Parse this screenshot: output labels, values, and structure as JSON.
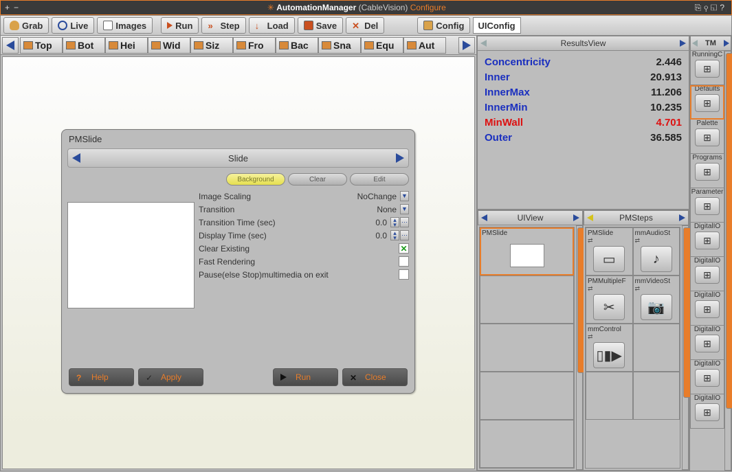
{
  "title": {
    "app": "AutomationManager",
    "project": "(CableVision)",
    "mode": "Configure"
  },
  "toolbar": {
    "grab": "Grab",
    "live": "Live",
    "images": "Images",
    "run": "Run",
    "step": "Step",
    "load": "Load",
    "save": "Save",
    "del": "Del",
    "config": "Config",
    "uiconfig": "UIConfig"
  },
  "sec_toolbar": {
    "items": [
      "Top",
      "Bot",
      "Hei",
      "Wid",
      "Siz",
      "Fro",
      "Bac",
      "Sna",
      "Equ",
      "Aut"
    ]
  },
  "dialog": {
    "title": "PMSlide",
    "header": "Slide",
    "tabs": {
      "background": "Background",
      "clear": "Clear",
      "edit": "Edit"
    },
    "props": {
      "image_scaling": {
        "label": "Image Scaling",
        "value": "NoChange"
      },
      "transition": {
        "label": "Transition",
        "value": "None"
      },
      "transition_time": {
        "label": "Transition Time (sec)",
        "value": "0.0"
      },
      "display_time": {
        "label": "Display Time (sec)",
        "value": "0.0"
      },
      "clear_existing": {
        "label": "Clear Existing",
        "value": true
      },
      "fast_rendering": {
        "label": "Fast Rendering",
        "value": false
      },
      "pause_stop": {
        "label": "Pause(else Stop)multimedia on exit",
        "value": false
      }
    },
    "buttons": {
      "help": "Help",
      "apply": "Apply",
      "run": "Run",
      "close": "Close"
    }
  },
  "results": {
    "title": "ResultsView",
    "rows": [
      {
        "name": "Concentricity",
        "value": "2.446",
        "alert": false
      },
      {
        "name": "Inner",
        "value": "20.913",
        "alert": false
      },
      {
        "name": "InnerMax",
        "value": "11.206",
        "alert": false
      },
      {
        "name": "InnerMin",
        "value": "10.235",
        "alert": false
      },
      {
        "name": "MinWall",
        "value": "4.701",
        "alert": true
      },
      {
        "name": "Outer",
        "value": "36.585",
        "alert": false
      }
    ]
  },
  "uiview": {
    "title": "UIView",
    "items": [
      "PMSlide",
      "",
      "",
      "",
      ""
    ]
  },
  "pmsteps": {
    "title": "PMSteps",
    "items": [
      {
        "label": "PMSlide",
        "icon": "▭"
      },
      {
        "label": "mmAudioSt",
        "icon": "♪"
      },
      {
        "label": "PMMultipleF",
        "icon": "✂"
      },
      {
        "label": "mmVideoSt",
        "icon": "📷"
      },
      {
        "label": "mmControl",
        "icon": "▯▮▶"
      },
      {
        "label": "",
        "icon": ""
      },
      {
        "label": "",
        "icon": ""
      },
      {
        "label": "",
        "icon": ""
      }
    ]
  },
  "tm": {
    "title": "TM",
    "items": [
      {
        "label": "RunningC",
        "sel": false
      },
      {
        "label": "Defaults",
        "sel": true
      },
      {
        "label": "Palette",
        "sel": false
      },
      {
        "label": "Programs",
        "sel": false
      },
      {
        "label": "Parameter",
        "sel": false
      },
      {
        "label": "DigitalIO",
        "sel": false
      },
      {
        "label": "DigitalIO",
        "sel": false
      },
      {
        "label": "DigitalIO",
        "sel": false
      },
      {
        "label": "DigitalIO",
        "sel": false
      },
      {
        "label": "DigitalIO",
        "sel": false
      },
      {
        "label": "DigitalIO",
        "sel": false
      }
    ]
  }
}
